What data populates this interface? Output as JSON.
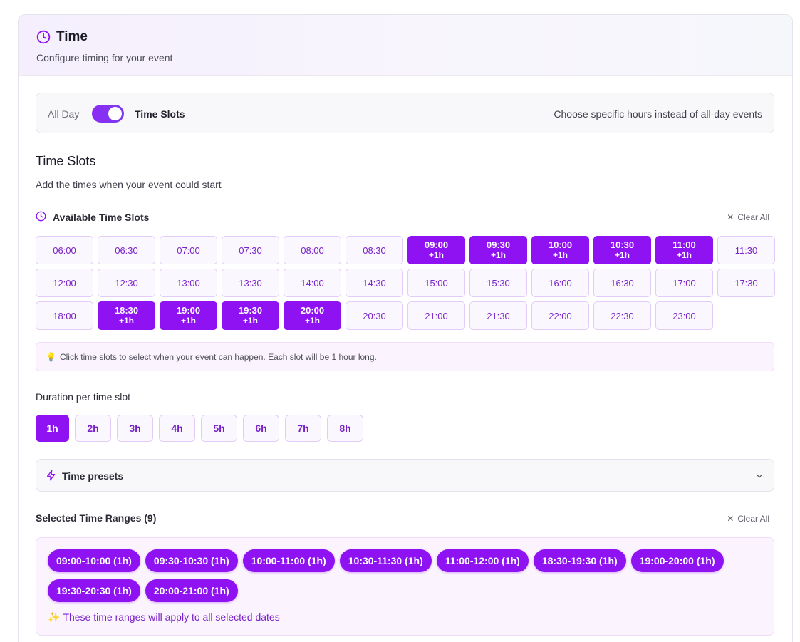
{
  "header": {
    "title": "Time",
    "subtitle": "Configure timing for your event",
    "icon": "clock-icon"
  },
  "mode_toggle": {
    "left_label": "All Day",
    "right_label": "Time Slots",
    "enabled": true,
    "hint": "Choose specific hours instead of all-day events"
  },
  "time_slots": {
    "title": "Time Slots",
    "subtitle": "Add the times when your event could start",
    "available_label": "Available Time Slots",
    "clear_label": "Clear All",
    "selected_suffix": "+1h",
    "slots": [
      {
        "time": "06:00",
        "selected": false
      },
      {
        "time": "06:30",
        "selected": false
      },
      {
        "time": "07:00",
        "selected": false
      },
      {
        "time": "07:30",
        "selected": false
      },
      {
        "time": "08:00",
        "selected": false
      },
      {
        "time": "08:30",
        "selected": false
      },
      {
        "time": "09:00",
        "selected": true
      },
      {
        "time": "09:30",
        "selected": true
      },
      {
        "time": "10:00",
        "selected": true
      },
      {
        "time": "10:30",
        "selected": true
      },
      {
        "time": "11:00",
        "selected": true
      },
      {
        "time": "11:30",
        "selected": false
      },
      {
        "time": "12:00",
        "selected": false
      },
      {
        "time": "12:30",
        "selected": false
      },
      {
        "time": "13:00",
        "selected": false
      },
      {
        "time": "13:30",
        "selected": false
      },
      {
        "time": "14:00",
        "selected": false
      },
      {
        "time": "14:30",
        "selected": false
      },
      {
        "time": "15:00",
        "selected": false
      },
      {
        "time": "15:30",
        "selected": false
      },
      {
        "time": "16:00",
        "selected": false
      },
      {
        "time": "16:30",
        "selected": false
      },
      {
        "time": "17:00",
        "selected": false
      },
      {
        "time": "17:30",
        "selected": false
      },
      {
        "time": "18:00",
        "selected": false
      },
      {
        "time": "18:30",
        "selected": true
      },
      {
        "time": "19:00",
        "selected": true
      },
      {
        "time": "19:30",
        "selected": true
      },
      {
        "time": "20:00",
        "selected": true
      },
      {
        "time": "20:30",
        "selected": false
      },
      {
        "time": "21:00",
        "selected": false
      },
      {
        "time": "21:30",
        "selected": false
      },
      {
        "time": "22:00",
        "selected": false
      },
      {
        "time": "22:30",
        "selected": false
      },
      {
        "time": "23:00",
        "selected": false
      }
    ],
    "tip": "Click time slots to select when your event can happen. Each slot will be 1 hour long."
  },
  "duration": {
    "label": "Duration per time slot",
    "options": [
      "1h",
      "2h",
      "3h",
      "4h",
      "5h",
      "6h",
      "7h",
      "8h"
    ],
    "selected": "1h"
  },
  "presets": {
    "label": "Time presets"
  },
  "selected_ranges": {
    "title": "Selected Time Ranges (9)",
    "clear_label": "Clear All",
    "ranges": [
      "09:00-10:00 (1h)",
      "09:30-10:30 (1h)",
      "10:00-11:00 (1h)",
      "10:30-11:30 (1h)",
      "11:00-12:00 (1h)",
      "18:30-19:30 (1h)",
      "19:00-20:00 (1h)",
      "19:30-20:30 (1h)",
      "20:00-21:00 (1h)"
    ],
    "note": "These time ranges will apply to all selected dates"
  },
  "colors": {
    "accent": "#8f12f2",
    "accent_text": "#7a22c9",
    "slot_bg": "#fbf7fe",
    "slot_border": "#e1cdf7"
  }
}
